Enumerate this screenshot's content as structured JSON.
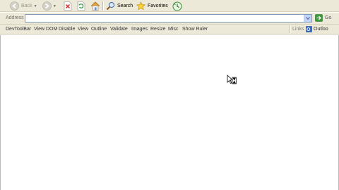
{
  "toolbar": {
    "back_label": "Back",
    "search_label": "Search",
    "favorites_label": "Favorites"
  },
  "address": {
    "label": "Address",
    "value": "",
    "go_label": "Go"
  },
  "devtoolbar": {
    "items": [
      "DevToolBar",
      "View DOM",
      "Disable",
      "View",
      "Outline",
      "Validate",
      "Images",
      "Resize",
      "Misc",
      "Show Ruler"
    ]
  },
  "links": {
    "label": "Links",
    "outlook_label": "Outloo"
  },
  "colors": {
    "chrome": "#ece9d8",
    "go_green": "#3a9a3a",
    "address_dropdown": "#c2d3fc"
  },
  "icons": [
    "back-arrow-icon",
    "forward-arrow-icon",
    "stop-icon",
    "refresh-icon",
    "home-icon",
    "search-icon",
    "favorites-star-icon",
    "history-icon",
    "go-arrow-icon",
    "outlook-icon",
    "busy-cursor-icon"
  ]
}
